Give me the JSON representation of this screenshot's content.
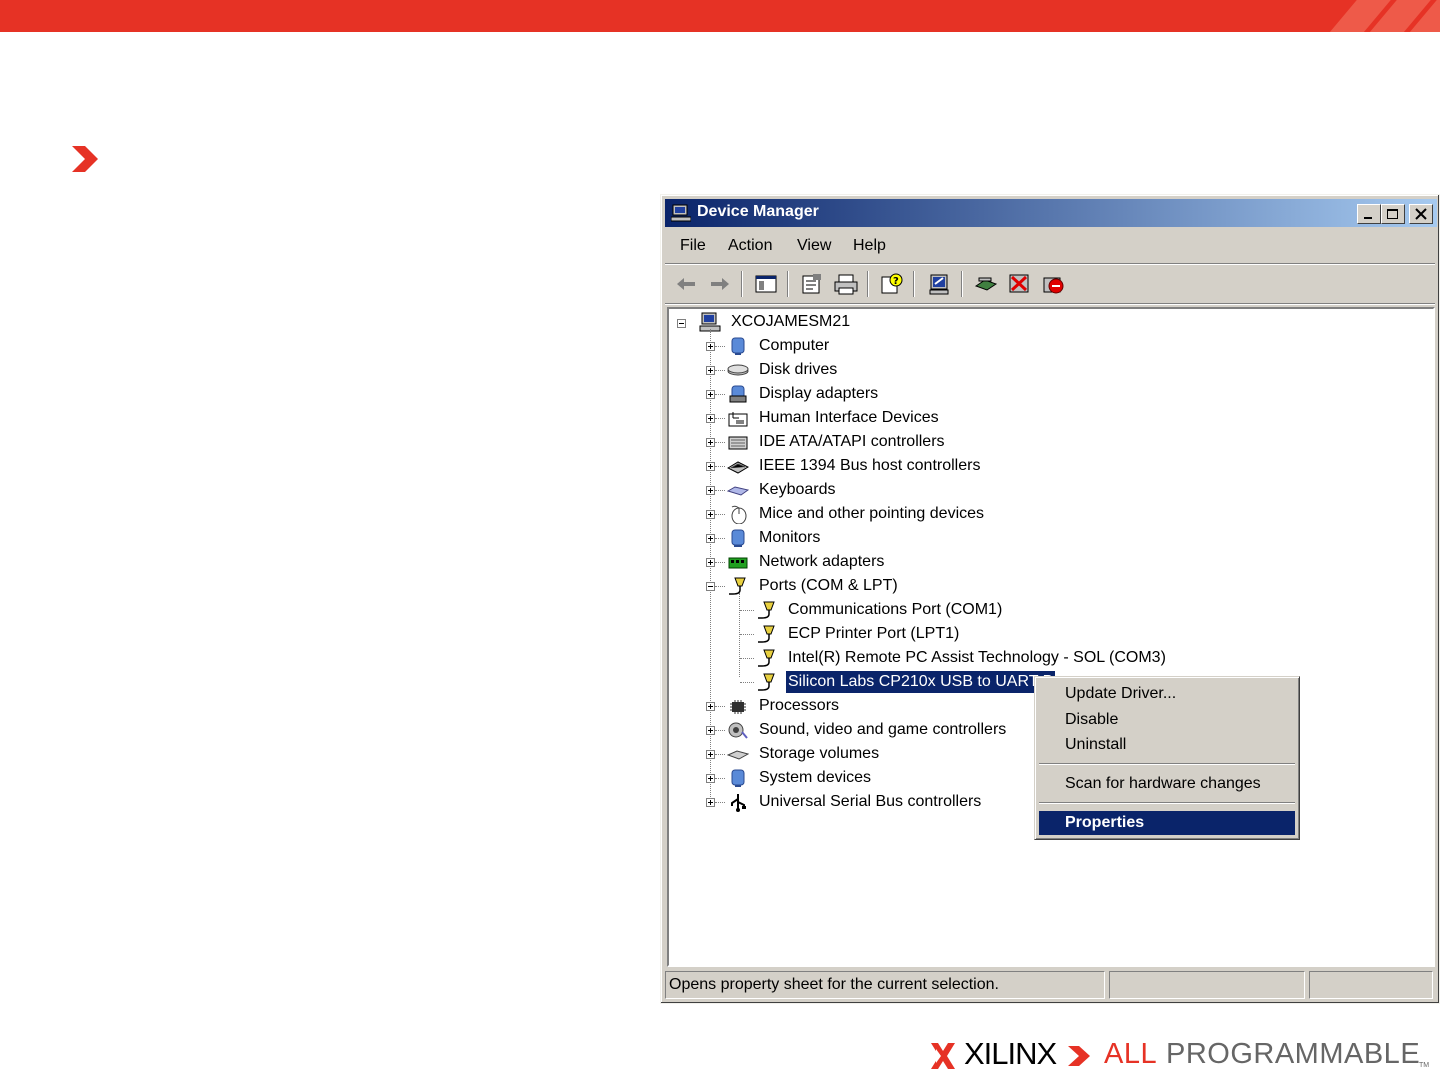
{
  "window": {
    "title": "Device Manager",
    "menu": [
      "File",
      "Action",
      "View",
      "Help"
    ],
    "status": "Opens property sheet for the current selection."
  },
  "tree": {
    "root": "XCOJAMESM21",
    "categories": [
      {
        "label": "Computer",
        "icon": "computer-icon"
      },
      {
        "label": "Disk drives",
        "icon": "disk-drive-icon"
      },
      {
        "label": "Display adapters",
        "icon": "display-adapter-icon"
      },
      {
        "label": "Human Interface Devices",
        "icon": "hid-icon"
      },
      {
        "label": "IDE ATA/ATAPI controllers",
        "icon": "ide-controller-icon"
      },
      {
        "label": "IEEE 1394 Bus host controllers",
        "icon": "ieee1394-icon"
      },
      {
        "label": "Keyboards",
        "icon": "keyboard-icon"
      },
      {
        "label": "Mice and other pointing devices",
        "icon": "mouse-icon"
      },
      {
        "label": "Monitors",
        "icon": "monitor-icon"
      },
      {
        "label": "Network adapters",
        "icon": "network-adapter-icon"
      },
      {
        "label": "Ports (COM & LPT)",
        "icon": "port-icon"
      },
      {
        "label": "Processors",
        "icon": "processor-icon"
      },
      {
        "label": "Sound, video and game controllers",
        "icon": "sound-icon"
      },
      {
        "label": "Storage volumes",
        "icon": "storage-volume-icon"
      },
      {
        "label": "System devices",
        "icon": "system-device-icon"
      },
      {
        "label": "Universal Serial Bus controllers",
        "icon": "usb-icon"
      }
    ],
    "ports": [
      "Communications Port (COM1)",
      "ECP Printer Port (LPT1)",
      "Intel(R) Remote PC Assist Technology - SOL (COM3)",
      "Silicon Labs CP210x USB to UART B"
    ]
  },
  "context_menu": {
    "items": [
      "Update Driver...",
      "Disable",
      "Uninstall",
      "Scan for hardware changes",
      "Properties"
    ]
  },
  "footer": {
    "brand": "XILINX",
    "tagline_a": "ALL",
    "tagline_b": "PROGRAMMABLE",
    "trademark": "TM"
  },
  "colors": {
    "accent": "#e63225",
    "title_bar_start": "#0a246a",
    "title_bar_end": "#a6caf0",
    "selection": "#0a246a",
    "window_face": "#d4d0c8"
  }
}
